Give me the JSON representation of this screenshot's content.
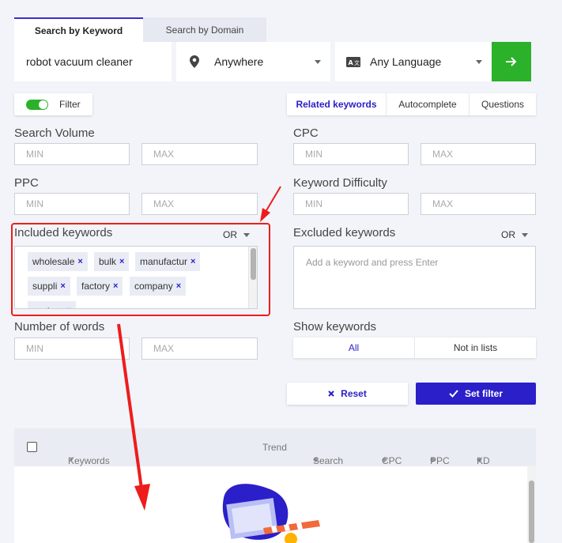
{
  "search": {
    "tabs": [
      "Search by Keyword",
      "Search by Domain"
    ],
    "keyword": "robot vacuum cleaner",
    "location": "Anywhere",
    "language": "Any Language"
  },
  "filter": {
    "toggle_label": "Filter"
  },
  "result_tabs": [
    "Related keywords",
    "Autocomplete",
    "Questions"
  ],
  "labels": {
    "search_volume": "Search Volume",
    "cpc": "CPC",
    "ppc": "PPC",
    "keyword_difficulty": "Keyword Difficulty",
    "included_keywords": "Included keywords",
    "excluded_keywords": "Excluded keywords",
    "number_of_words": "Number of words",
    "show_keywords": "Show keywords",
    "or": "OR"
  },
  "placeholders": {
    "min": "MIN",
    "max": "MAX",
    "excluded": "Add a keyword and press Enter"
  },
  "included_tags": [
    "wholesale",
    "bulk",
    "manufactur",
    "suppli",
    "factory",
    "company",
    "custom"
  ],
  "show_options": [
    "All",
    "Not in lists"
  ],
  "buttons": {
    "reset": "Reset",
    "set_filter": "Set filter"
  },
  "table_headers": [
    "Keywords",
    "Trend",
    "Search",
    "CPC",
    "PPC",
    "KD"
  ],
  "colors": {
    "accent": "#2a1fc9",
    "go": "#2bb12a",
    "highlight": "#ee1c1c"
  }
}
